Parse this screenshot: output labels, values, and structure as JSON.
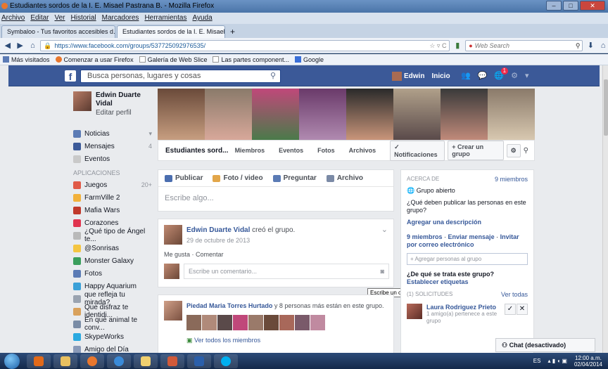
{
  "window": {
    "title": "Estudiantes sordos de la I. E. Misael Pastrana B. - Mozilla Firefox",
    "controls": [
      "–",
      "□",
      "✕"
    ]
  },
  "menu": [
    "Archivo",
    "Editar",
    "Ver",
    "Historial",
    "Marcadores",
    "Herramientas",
    "Ayuda"
  ],
  "tabs": [
    {
      "label": "Symbaloo - Tus favoritos accesibles d...",
      "close": "×"
    },
    {
      "label": "Estudiantes sordos de la I. E. Misael P...",
      "close": "×"
    }
  ],
  "new_tab": "+",
  "url": "https://www.facebook.com/groups/537725092976535/",
  "search_placeholder": "Web Search",
  "bookmarks": [
    "Más visitados",
    "Comenzar a usar Firefox",
    "Galería de Web Slice",
    "Las partes component...",
    "Google"
  ],
  "fb": {
    "logo": "f",
    "search_placeholder": "Busca personas, lugares y cosas",
    "user": "Edwin",
    "home": "Inicio",
    "notif_count": "1"
  },
  "left": {
    "profile_name": "Edwin Duarte Vidal",
    "edit_profile": "Editar perfil",
    "nav": [
      {
        "label": "Noticias",
        "count": "▾",
        "color": "#5b7bb5"
      },
      {
        "label": "Mensajes",
        "count": "4",
        "color": "#3b5998"
      },
      {
        "label": "Eventos",
        "count": "",
        "color": "#c9c9c9"
      }
    ],
    "apps_header": "APLICACIONES",
    "apps": [
      {
        "label": "Juegos",
        "count": "20+",
        "color": "#e05a47"
      },
      {
        "label": "FarmVille 2",
        "count": "",
        "color": "#f2b13b"
      },
      {
        "label": "Mafia Wars",
        "count": "",
        "color": "#c0392b"
      },
      {
        "label": "Corazones",
        "count": "",
        "color": "#e0344f"
      },
      {
        "label": "¿Qué tipo de Ángel te...",
        "count": "",
        "color": "#b9b9b9"
      },
      {
        "label": "@Sonrisas",
        "count": "",
        "color": "#f4c542"
      },
      {
        "label": "Monster Galaxy",
        "count": "",
        "color": "#3a9e5c"
      },
      {
        "label": "Fotos",
        "count": "",
        "color": "#5b7bb5"
      },
      {
        "label": "Happy Aquarium",
        "count": "",
        "color": "#3aa0d8"
      },
      {
        "label": "que refleja tu mirada?",
        "count": "",
        "color": "#9aa3b0"
      },
      {
        "label": "Que disfraz te identidi...",
        "count": "",
        "color": "#d9a15b"
      },
      {
        "label": "En qué animal te conv...",
        "count": "",
        "color": "#7a8ca6"
      },
      {
        "label": "SkypeWorks",
        "count": "",
        "color": "#2aa9e0"
      },
      {
        "label": "Amigo del Día",
        "count": "",
        "color": "#8a9ab8"
      }
    ]
  },
  "group": {
    "name": "Estudiantes sord...",
    "tabs": [
      "Miembros",
      "Eventos",
      "Fotos",
      "Archivos"
    ],
    "notif_btn": "✓ Notificaciones",
    "create_btn": "+ Crear un grupo"
  },
  "composer": {
    "tabs": [
      {
        "label": "Publicar",
        "color": "#4b6eaf"
      },
      {
        "label": "Foto / video",
        "color": "#e2a64a"
      },
      {
        "label": "Preguntar",
        "color": "#5b7bb5"
      },
      {
        "label": "Archivo",
        "color": "#7b8aa6"
      }
    ],
    "placeholder": "Escribe algo..."
  },
  "post1": {
    "author": "Edwin Duarte Vidal",
    "action": " creó el grupo.",
    "date": "29 de octubre de 2013",
    "like": "Me gusta",
    "sep": " · ",
    "comment": "Comentar",
    "comment_placeholder": "Escribe un comentario..."
  },
  "tooltip": "Escribe un comentario...",
  "post2": {
    "author": "Piedad Maria Torres Hurtado",
    "rest": " y 8 personas más están en este grupo.",
    "see_all": "Ver todos los miembros"
  },
  "about": {
    "header": "ACERCA DE",
    "members": "9 miembros",
    "open": "Grupo abierto",
    "question": "¿Qué deben publicar las personas en este grupo?",
    "add_desc": "Agregar una descripción",
    "members2": "9 miembros",
    "send_msg": "Enviar mensaje",
    "invite": "Invitar por correo electrónico",
    "add_people": "+ Agregar personas al grupo",
    "what": "¿De qué se trata este grupo?",
    "set_tags": "Establecer etiquetas",
    "requests": "(1) SOLICITUDES",
    "see_all": "Ver todas",
    "req_name": "Laura Rodriguez Prieto",
    "req_sub": "1 amigo(a) pertenece a este grupo"
  },
  "chat": "Chat (desactivado)",
  "tray": {
    "lang": "ES",
    "time": "12:00 a.m.",
    "date": "02/04/2014"
  },
  "colors": {
    "fb_blue": "#3b5998",
    "link": "#365899"
  }
}
